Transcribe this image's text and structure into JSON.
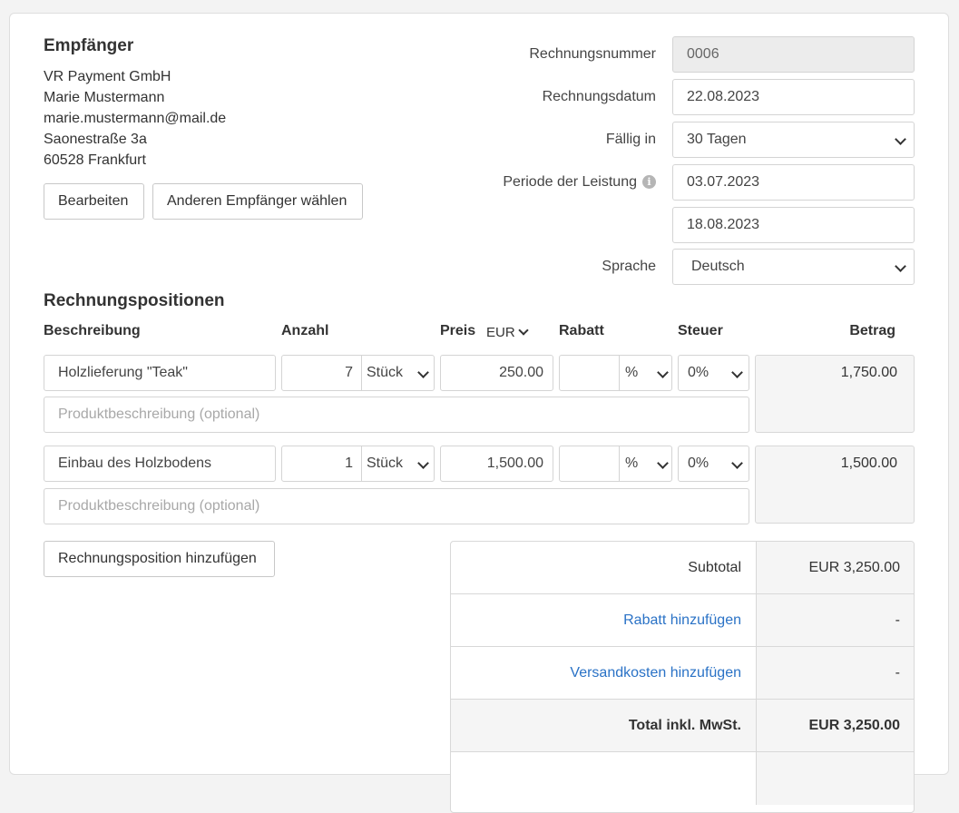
{
  "recipient": {
    "heading": "Empfänger",
    "lines": [
      "VR Payment GmbH",
      "Marie Mustermann",
      "marie.mustermann@mail.de",
      "Saonestraße 3a",
      "60528 Frankfurt"
    ],
    "edit_label": "Bearbeiten",
    "other_label": "Anderen Empfänger wählen"
  },
  "invoice": {
    "number_label": "Rechnungsnummer",
    "number_value": "0006",
    "date_label": "Rechnungsdatum",
    "date_value": "22.08.2023",
    "due_label": "Fällig in",
    "due_value": "30 Tagen",
    "period_label": "Periode der Leistung",
    "period_from": "03.07.2023",
    "period_to": "18.08.2023",
    "language_label": "Sprache",
    "language_value": "Deutsch",
    "info_icon": "i"
  },
  "positions": {
    "heading": "Rechnungspositionen",
    "col_description": "Beschreibung",
    "col_quantity": "Anzahl",
    "col_price": "Preis",
    "currency": "EUR",
    "col_discount": "Rabatt",
    "col_tax": "Steuer",
    "col_amount": "Betrag",
    "items": [
      {
        "description": "Holzlieferung \"Teak\"",
        "quantity": "7",
        "unit": "Stück",
        "price": "250.00",
        "discount": "",
        "discount_type": "%",
        "tax": "0%",
        "amount": "1,750.00",
        "product_placeholder": "Produktbeschreibung (optional)"
      },
      {
        "description": "Einbau des Holzbodens",
        "quantity": "1",
        "unit": "Stück",
        "price": "1,500.00",
        "discount": "",
        "discount_type": "%",
        "tax": "0%",
        "amount": "1,500.00",
        "product_placeholder": "Produktbeschreibung (optional)"
      }
    ],
    "add_label": "Rechnungsposition hinzufügen"
  },
  "totals": {
    "subtotal_label": "Subtotal",
    "subtotal_value": "EUR 3,250.00",
    "discount_link": "Rabatt hinzufügen",
    "discount_value": "-",
    "shipping_link": "Versandkosten hinzufügen",
    "shipping_value": "-",
    "total_label": "Total inkl. MwSt.",
    "total_value": "EUR 3,250.00"
  },
  "colors": {
    "link": "#2a72c6",
    "readonly_bg": "#ececec",
    "panel_bg": "#f5f5f5"
  }
}
